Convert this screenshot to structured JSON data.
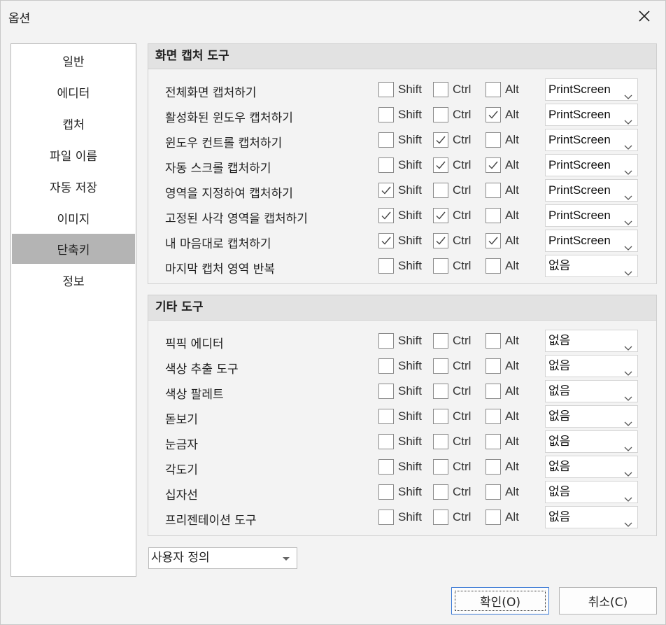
{
  "window": {
    "title": "옵션"
  },
  "sidebar": {
    "items": [
      {
        "label": "일반"
      },
      {
        "label": "에디터"
      },
      {
        "label": "캡처"
      },
      {
        "label": "파일 이름"
      },
      {
        "label": "자동 저장"
      },
      {
        "label": "이미지"
      },
      {
        "label": "단축키",
        "active": true
      },
      {
        "label": "정보"
      }
    ]
  },
  "modifiers": {
    "shift": "Shift",
    "ctrl": "Ctrl",
    "alt": "Alt"
  },
  "groups": [
    {
      "title": "화면 캡처 도구",
      "rows": [
        {
          "label": "전체화면 캡처하기",
          "shift": false,
          "ctrl": false,
          "alt": false,
          "key": "PrintScreen"
        },
        {
          "label": "활성화된 윈도우 캡처하기",
          "shift": false,
          "ctrl": false,
          "alt": true,
          "key": "PrintScreen"
        },
        {
          "label": "윈도우 컨트롤 캡처하기",
          "shift": false,
          "ctrl": true,
          "alt": false,
          "key": "PrintScreen"
        },
        {
          "label": "자동 스크롤 캡처하기",
          "shift": false,
          "ctrl": true,
          "alt": true,
          "key": "PrintScreen"
        },
        {
          "label": "영역을 지정하여 캡처하기",
          "shift": true,
          "ctrl": false,
          "alt": false,
          "key": "PrintScreen"
        },
        {
          "label": "고정된 사각 영역을 캡처하기",
          "shift": true,
          "ctrl": true,
          "alt": false,
          "key": "PrintScreen"
        },
        {
          "label": "내 마음대로 캡처하기",
          "shift": true,
          "ctrl": true,
          "alt": true,
          "key": "PrintScreen"
        },
        {
          "label": "마지막 캡처 영역 반복",
          "shift": false,
          "ctrl": false,
          "alt": false,
          "key": "없음"
        }
      ]
    },
    {
      "title": "기타 도구",
      "rows": [
        {
          "label": "픽픽 에디터",
          "shift": false,
          "ctrl": false,
          "alt": false,
          "key": "없음"
        },
        {
          "label": "색상 추출 도구",
          "shift": false,
          "ctrl": false,
          "alt": false,
          "key": "없음"
        },
        {
          "label": "색상 팔레트",
          "shift": false,
          "ctrl": false,
          "alt": false,
          "key": "없음"
        },
        {
          "label": "돋보기",
          "shift": false,
          "ctrl": false,
          "alt": false,
          "key": "없음"
        },
        {
          "label": "눈금자",
          "shift": false,
          "ctrl": false,
          "alt": false,
          "key": "없음"
        },
        {
          "label": "각도기",
          "shift": false,
          "ctrl": false,
          "alt": false,
          "key": "없음"
        },
        {
          "label": "십자선",
          "shift": false,
          "ctrl": false,
          "alt": false,
          "key": "없음"
        },
        {
          "label": "프리젠테이션 도구",
          "shift": false,
          "ctrl": false,
          "alt": false,
          "key": "없음"
        }
      ]
    }
  ],
  "preset": {
    "value": "사용자 정의"
  },
  "buttons": {
    "ok": "확인(O)",
    "cancel": "취소(C)"
  }
}
